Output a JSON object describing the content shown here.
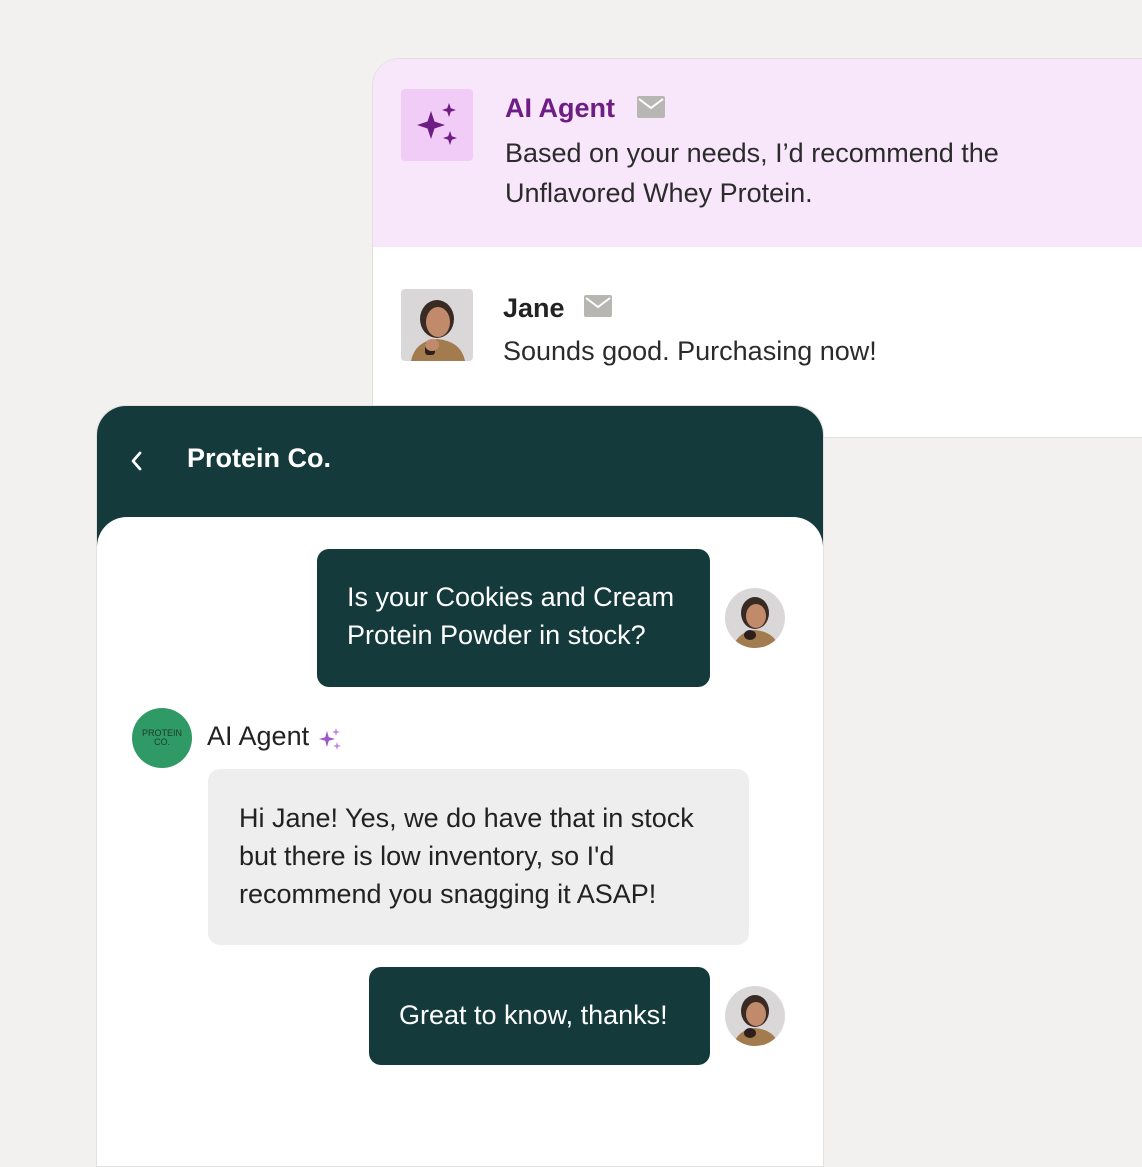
{
  "thread": {
    "ai_row": {
      "name": "AI Agent",
      "message": "Based on your needs, I’d recommend the Unflavored Whey Protein.",
      "icon": "sparkles-icon",
      "channel_icon": "mail-icon"
    },
    "user_row": {
      "name": "Jane",
      "message": "Sounds good. Purchasing now!",
      "channel_icon": "mail-icon"
    }
  },
  "chat": {
    "title": "Protein Co.",
    "back_icon": "chevron-left-icon",
    "brand_logo_text": [
      "PROTEIN",
      "CO."
    ],
    "agent_name": "AI Agent",
    "messages": [
      {
        "from": "user",
        "text": "Is your Cookies and Cream Protein Powder in stock?"
      },
      {
        "from": "agent",
        "text": "Hi Jane! Yes, we do have that in stock but there is low inventory, so I'd recommend you snagging it ASAP!"
      },
      {
        "from": "user",
        "text": "Great to know, thanks!"
      }
    ]
  },
  "colors": {
    "page_bg": "#f2f1ef",
    "ai_row_bg": "#f8e6fb",
    "ai_accent": "#6e1d84",
    "chat_dark": "#143a3c",
    "brand_green": "#2f9a66",
    "agent_bubble": "#eeeeee"
  }
}
